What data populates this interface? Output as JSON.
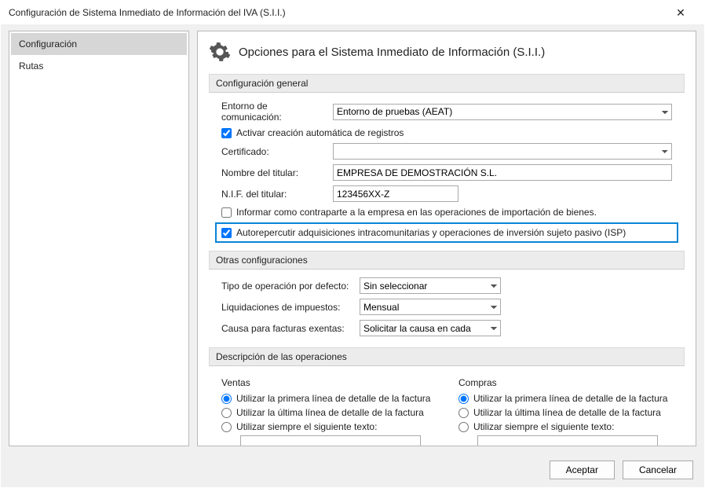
{
  "window": {
    "title": "Configuración de Sistema Inmediato de Información del IVA (S.I.I.)"
  },
  "sidebar": {
    "items": [
      {
        "label": "Configuración"
      },
      {
        "label": "Rutas"
      }
    ]
  },
  "header": {
    "title": "Opciones para el Sistema Inmediato de Información (S.I.I.)"
  },
  "sec_general": {
    "title": "Configuración general",
    "entorno_label": "Entorno de comunicación:",
    "entorno_value": "Entorno de pruebas (AEAT)",
    "activar_label": "Activar creación automática de registros",
    "activar_checked": true,
    "cert_label": "Certificado:",
    "cert_value": "",
    "nombre_label": "Nombre del titular:",
    "nombre_value": "EMPRESA DE DEMOSTRACIÓN S.L.",
    "nif_label": "N.I.F. del titular:",
    "nif_value": "123456XX-Z",
    "informar_label": "Informar como contraparte a la empresa en las operaciones de importación de bienes.",
    "informar_checked": false,
    "autorep_label": "Autorepercutir adquisiciones intracomunitarias y operaciones de inversión sujeto pasivo (ISP)",
    "autorep_checked": true
  },
  "sec_other": {
    "title": "Otras configuraciones",
    "tipo_label": "Tipo de operación por defecto:",
    "tipo_value": "Sin seleccionar",
    "liq_label": "Liquidaciones de impuestos:",
    "liq_value": "Mensual",
    "causa_label": "Causa para facturas exentas:",
    "causa_value": "Solicitar la causa en cada"
  },
  "sec_desc": {
    "title": "Descripción de las operaciones",
    "ventas_title": "Ventas",
    "compras_title": "Compras",
    "opt_first": "Utilizar la primera línea de detalle de la factura",
    "opt_last": "Utilizar la última línea de detalle de la factura",
    "opt_text": "Utilizar siempre el siguiente texto:",
    "ventas_selected": "first",
    "compras_selected": "first",
    "ventas_custom": "",
    "compras_custom": ""
  },
  "footer": {
    "accept": "Aceptar",
    "cancel": "Cancelar"
  }
}
